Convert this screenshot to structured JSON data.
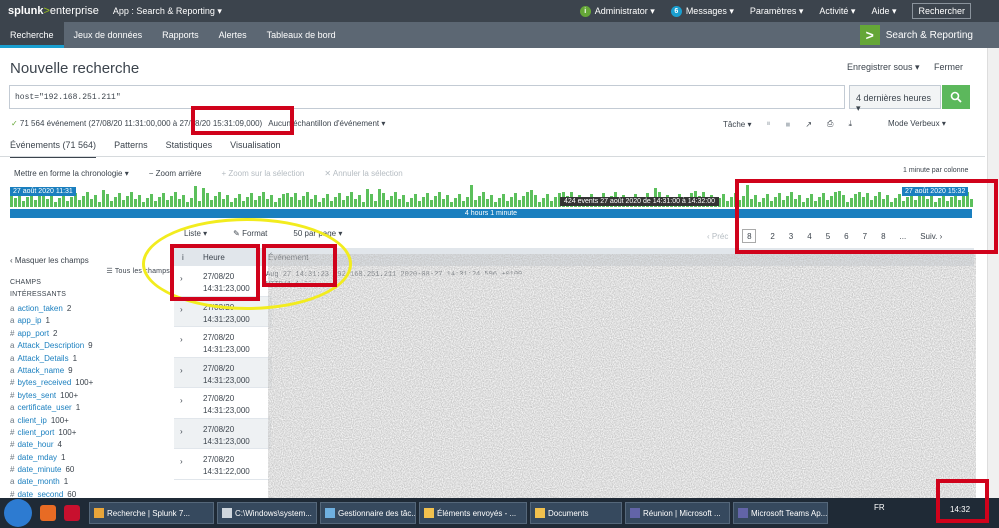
{
  "topbar": {
    "brand_a": "splunk",
    "brand_b": ">",
    "brand_c": "enterprise",
    "app": "App : Search & Reporting ▾",
    "items": [
      {
        "label": "Administrator ▾",
        "icon": "info-icon",
        "badge": "i"
      },
      {
        "label": "Messages ▾",
        "icon": "messages-badge",
        "badge": "6"
      },
      {
        "label": "Paramètres ▾"
      },
      {
        "label": "Activité ▾"
      },
      {
        "label": "Aide ▾"
      }
    ],
    "search": "Rechercher"
  },
  "nav": {
    "items": [
      "Recherche",
      "Jeux de données",
      "Rapports",
      "Alertes",
      "Tableaux de bord"
    ],
    "app_name": "Search & Reporting",
    "logo_glyph": ">"
  },
  "page": {
    "title": "Nouvelle recherche",
    "save_as": "Enregistrer sous ▾",
    "close": "Fermer"
  },
  "search": {
    "query": "host=\"192.168.251.211\"",
    "time_range": "4 dernières heures ▾",
    "go_icon": "search-icon"
  },
  "status": {
    "check": "✓",
    "count_text": " 71 564 événement (27/08/20 11:31:00,000 à 27/08/20 15:31:09,000)",
    "sampling": "Aucun échantillon d'événement ▾",
    "job": "Tâche ▾",
    "mode": "Mode Verbeux ▾",
    "job_icons": [
      "pause-icon",
      "stop-icon",
      "share-icon",
      "print-icon",
      "export-icon"
    ]
  },
  "tabs": [
    "Événements (71 564)",
    "Patterns",
    "Statistiques",
    "Visualisation"
  ],
  "timeline": {
    "format": "Mettre en forme la chronologie ▾",
    "zoom_out": "− Zoom arrière",
    "zoom_sel": "+ Zoom sur la sélection",
    "cancel_sel": "✕ Annuler la sélection",
    "per_col": "1 minute par colonne",
    "start": "27 août 2020 11:31",
    "end": "27 août 2020 15:32",
    "span": "4 hours 1 minute",
    "tooltip": "424 events 27 août 2020 de 14:31:00 à 14:32:00"
  },
  "results": {
    "list": "Liste ▾",
    "format": "✎ Format",
    "per_page": "50 par page ▾",
    "prev": "‹ Préc",
    "pages": [
      "8",
      "2",
      "3",
      "4",
      "5",
      "6",
      "7",
      "8",
      "..."
    ],
    "next": "Suiv. ›"
  },
  "fields": {
    "hide": "‹ Masquer les champs",
    "all": "☰ Tous les champs",
    "header": "CHAMPS INTÉRESSANTS",
    "list": [
      {
        "type": "a",
        "name": "action_taken",
        "count": "2"
      },
      {
        "type": "a",
        "name": "app_ip",
        "count": "1"
      },
      {
        "type": "#",
        "name": "app_port",
        "count": "2"
      },
      {
        "type": "a",
        "name": "Attack_Description",
        "count": "9"
      },
      {
        "type": "a",
        "name": "Attack_Details",
        "count": "1"
      },
      {
        "type": "a",
        "name": "Attack_name",
        "count": "9"
      },
      {
        "type": "#",
        "name": "bytes_received",
        "count": "100+"
      },
      {
        "type": "#",
        "name": "bytes_sent",
        "count": "100+"
      },
      {
        "type": "a",
        "name": "certificate_user",
        "count": "1"
      },
      {
        "type": "a",
        "name": "client_ip",
        "count": "100+"
      },
      {
        "type": "#",
        "name": "client_port",
        "count": "100+"
      },
      {
        "type": "#",
        "name": "date_hour",
        "count": "4"
      },
      {
        "type": "#",
        "name": "date_mday",
        "count": "1"
      },
      {
        "type": "#",
        "name": "date_minute",
        "count": "60"
      },
      {
        "type": "a",
        "name": "date_month",
        "count": "1"
      },
      {
        "type": "#",
        "name": "date_second",
        "count": "60"
      }
    ]
  },
  "table": {
    "info": "i",
    "col_time": "Heure",
    "col_event": "Événement",
    "rows": [
      {
        "date": "27/08/20",
        "time": "14:31:23,000"
      },
      {
        "date": "27/08/20",
        "time": "14:31:23,000"
      },
      {
        "date": "27/08/20",
        "time": "14:31:23,000"
      },
      {
        "date": "27/08/20",
        "time": "14:31:23,000"
      },
      {
        "date": "27/08/20",
        "time": "14:31:23,000"
      },
      {
        "date": "27/08/20",
        "time": "14:31:23,000"
      },
      {
        "date": "27/08/20",
        "time": "14:31:22,000"
      }
    ],
    "event_line1": "Aug 27 14:31:23 192.168.251.211 2020-08-27 14:31:24.596 +0100",
    "event_line2": "HTTP/1.1 200 000 SERVICE"
  },
  "taskbar": {
    "items": [
      {
        "label": "Recherche | Splunk 7...",
        "color": "#e8a53a"
      },
      {
        "label": "C:\\Windows\\system...",
        "color": "#cfd6dd"
      },
      {
        "label": "Gestionnaire des tâc...",
        "color": "#6fb0e0"
      },
      {
        "label": "Éléments envoyés - ...",
        "color": "#f2c14e"
      },
      {
        "label": "Documents",
        "color": "#f2c14e"
      },
      {
        "label": "Réunion | Microsoft ...",
        "color": "#6264a7"
      },
      {
        "label": "Microsoft Teams Ap...",
        "color": "#6264a7"
      }
    ],
    "lang": "FR",
    "clock": "14:32"
  }
}
